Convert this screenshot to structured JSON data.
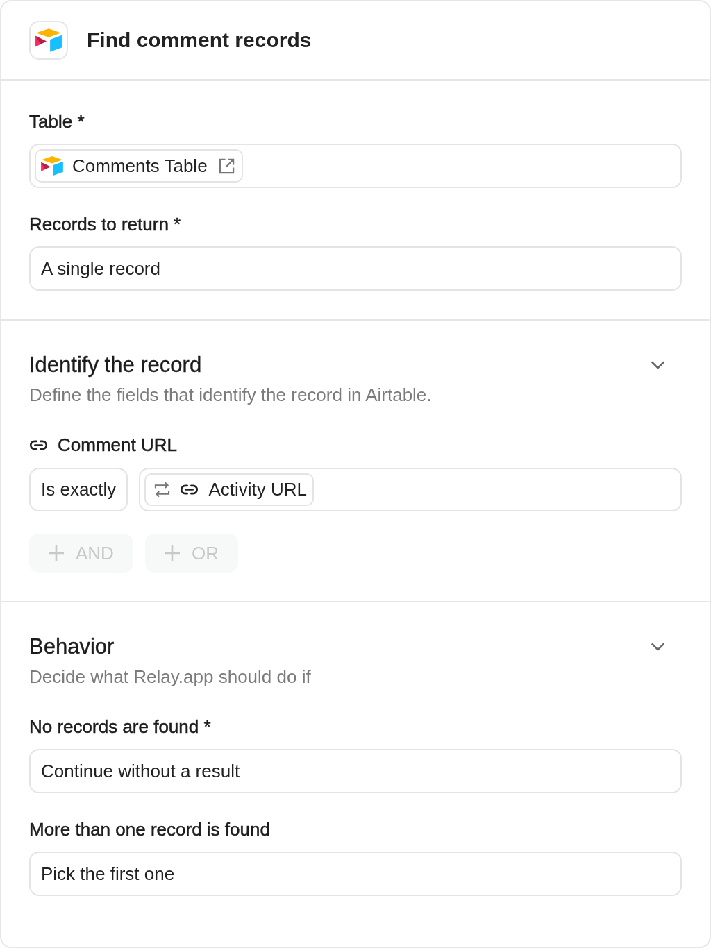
{
  "header": {
    "title": "Find comment records"
  },
  "table_section": {
    "fields": [
      {
        "label": "Table *",
        "kind": "table_chip",
        "value": "Comments Table"
      },
      {
        "label": "Records to return *",
        "kind": "text",
        "value": "A single record"
      }
    ]
  },
  "identify_section": {
    "title": "Identify the record",
    "subtitle": "Define the fields that identify the record in Airtable.",
    "condition": {
      "field": "Comment URL",
      "operator": "Is exactly",
      "value": "Activity URL"
    },
    "buttons": [
      {
        "label": "AND",
        "disabled": true
      },
      {
        "label": "OR",
        "disabled": true
      }
    ]
  },
  "behavior_section": {
    "title": "Behavior",
    "subtitle": "Decide what Relay.app should do if",
    "fields": [
      {
        "label": "No records are found *",
        "kind": "text",
        "value": "Continue without a result"
      },
      {
        "label": "More than one record is found",
        "kind": "text",
        "value": "Pick the first one"
      }
    ]
  }
}
